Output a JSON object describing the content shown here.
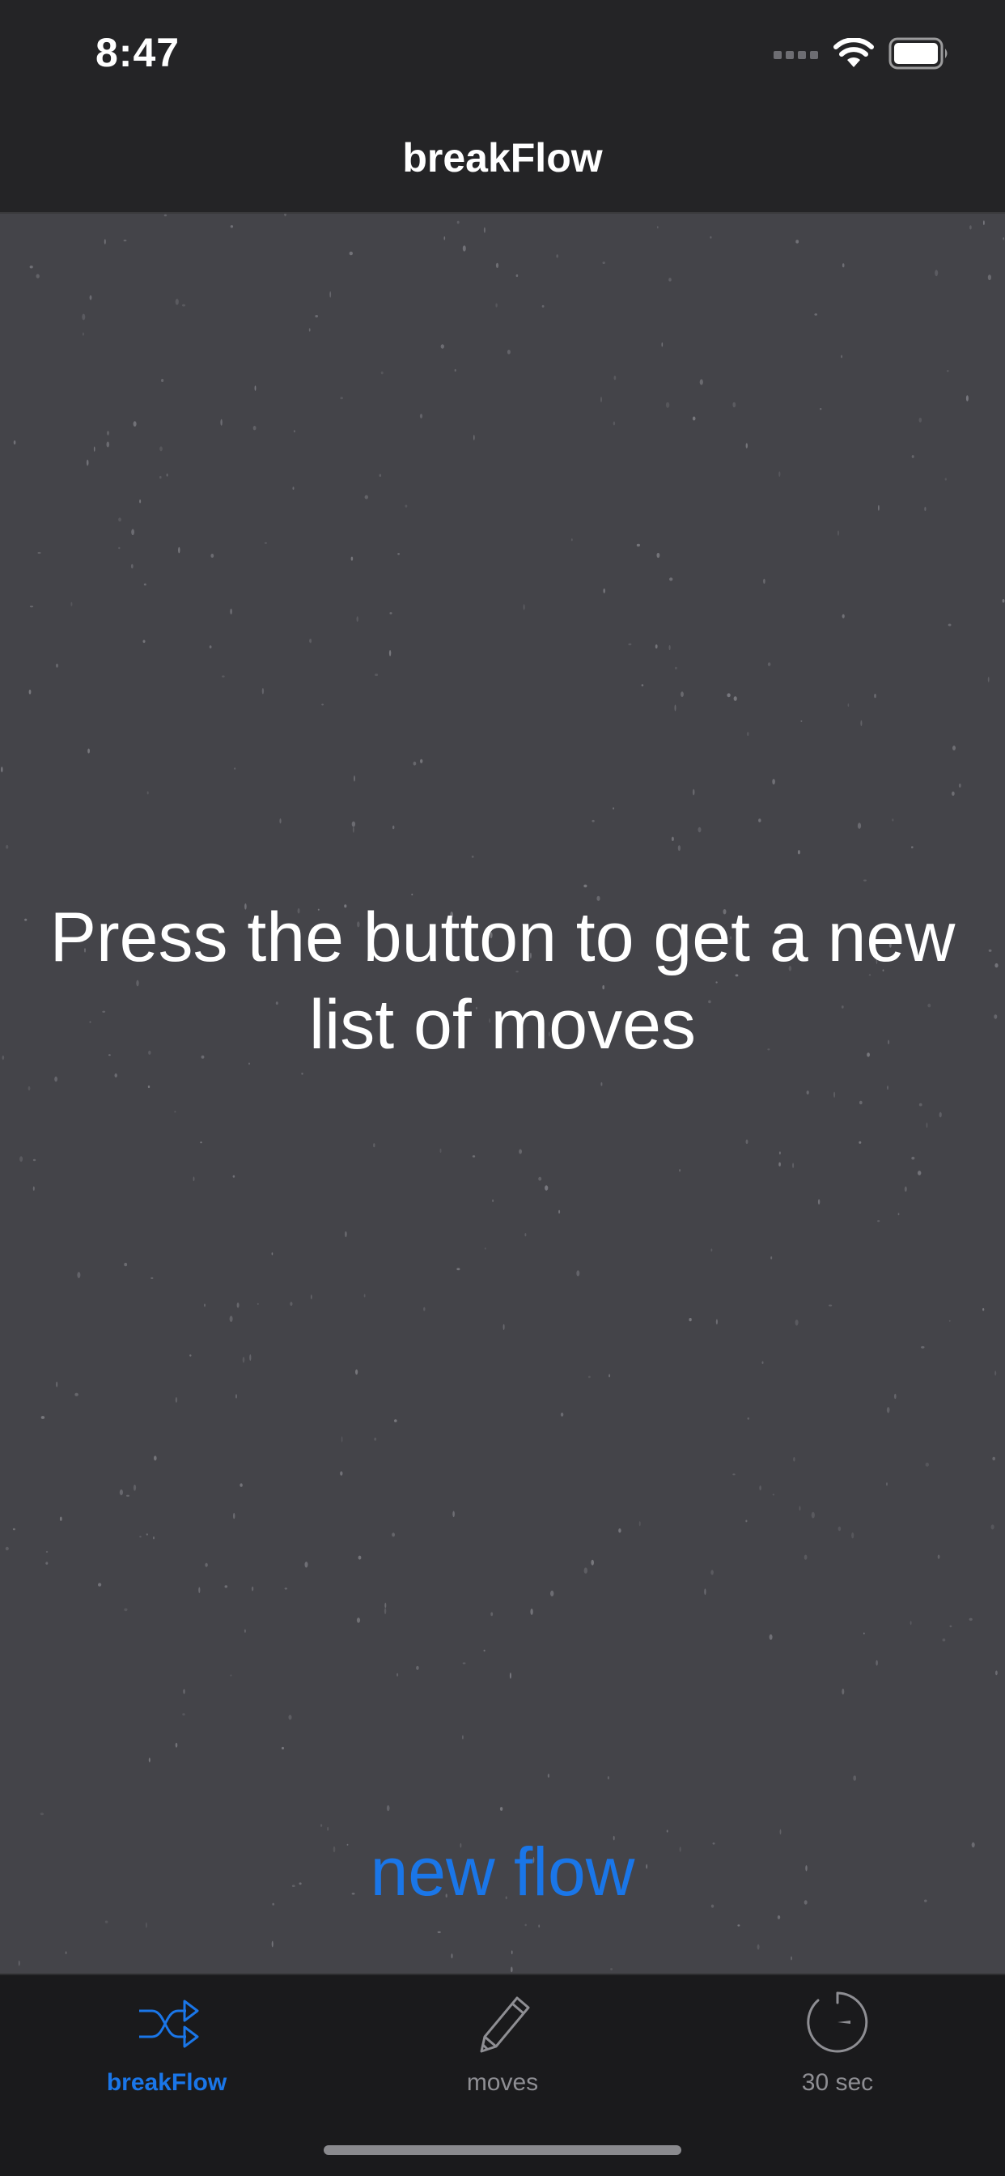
{
  "status_bar": {
    "time": "8:47"
  },
  "nav": {
    "title": "breakFlow"
  },
  "main": {
    "prompt": "Press the button to get a new list of moves",
    "button_label": "new flow"
  },
  "tab_bar": {
    "tabs": [
      {
        "label": "breakFlow",
        "icon": "shuffle-icon",
        "active": true
      },
      {
        "label": "moves",
        "icon": "pencil-icon",
        "active": false
      },
      {
        "label": "30 sec",
        "icon": "timer-icon",
        "active": false
      }
    ]
  },
  "colors": {
    "accent": "#1a76e8",
    "background": "#444449",
    "bar": "#242426"
  }
}
